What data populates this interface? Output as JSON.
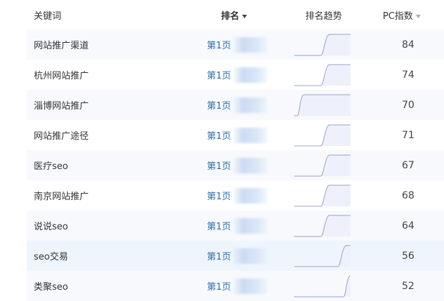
{
  "header": {
    "keyword": "关键词",
    "rank": "排名",
    "trend": "排名趋势",
    "pc_index": "PC指数"
  },
  "rows": [
    {
      "keyword": "网站推广渠道",
      "rank": "第1页",
      "pc": "84",
      "trend": "rise-late"
    },
    {
      "keyword": "杭州网站推广",
      "rank": "第1页",
      "pc": "74",
      "trend": "rise-late"
    },
    {
      "keyword": "淄博网站推广",
      "rank": "第1页",
      "pc": "70",
      "trend": "rise-early"
    },
    {
      "keyword": "网站推广途径",
      "rank": "第1页",
      "pc": "71",
      "trend": "rise-late"
    },
    {
      "keyword": "医疗seo",
      "rank": "第1页",
      "pc": "67",
      "trend": "rise-late"
    },
    {
      "keyword": "南京网站推广",
      "rank": "第1页",
      "pc": "68",
      "trend": "rise-late"
    },
    {
      "keyword": "说说seo",
      "rank": "第1页",
      "pc": "64",
      "trend": "rise-late"
    },
    {
      "keyword": "seo交易",
      "rank": "第1页",
      "pc": "56",
      "trend": "rise-very-late"
    },
    {
      "keyword": "类聚seo",
      "rank": "第1页",
      "pc": "52",
      "trend": "rise-edge"
    }
  ],
  "colors": {
    "link": "#2f6ea8",
    "stripe": "#f7f9fd",
    "hover": "#eef5fd",
    "trend_line": "#9aa4c8",
    "trend_fill": "#eef0fb"
  }
}
